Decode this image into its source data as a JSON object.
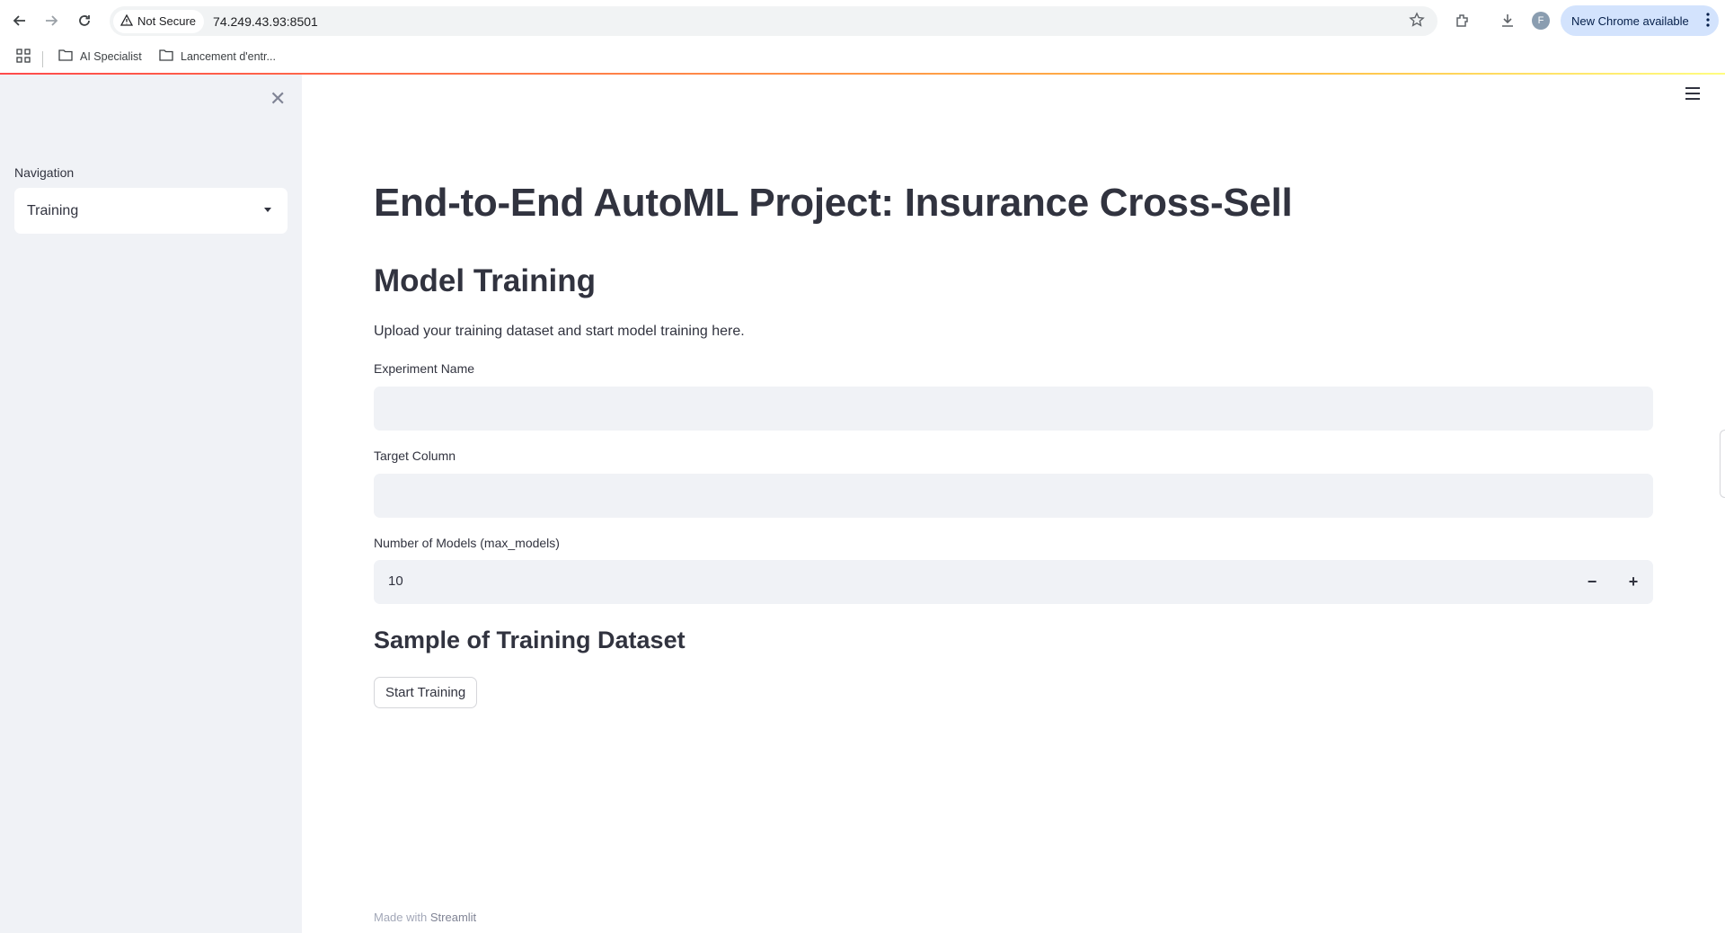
{
  "browser": {
    "security_label": "Not Secure",
    "url": "74.249.43.93:8501",
    "avatar_initial": "F",
    "update_label": "New Chrome available",
    "bookmarks": [
      {
        "label": "AI Specialist"
      },
      {
        "label": "Lancement d'entr..."
      }
    ]
  },
  "sidebar": {
    "nav_label": "Navigation",
    "nav_selected": "Training"
  },
  "main": {
    "title": "End-to-End AutoML Project: Insurance Cross-Sell",
    "section_title": "Model Training",
    "description": "Upload your training dataset and start model training here.",
    "fields": {
      "experiment_name": {
        "label": "Experiment Name",
        "value": ""
      },
      "target_column": {
        "label": "Target Column",
        "value": ""
      },
      "max_models": {
        "label": "Number of Models (max_models)",
        "value": "10",
        "minus": "−",
        "plus": "+"
      }
    },
    "sample_title": "Sample of Training Dataset",
    "start_button": "Start Training",
    "footer_prefix": "Made with",
    "footer_brand": "Streamlit"
  },
  "colors": {
    "accent_red": "#ff4b4b",
    "sidebar_bg": "#f0f2f6",
    "text": "#31333f"
  }
}
